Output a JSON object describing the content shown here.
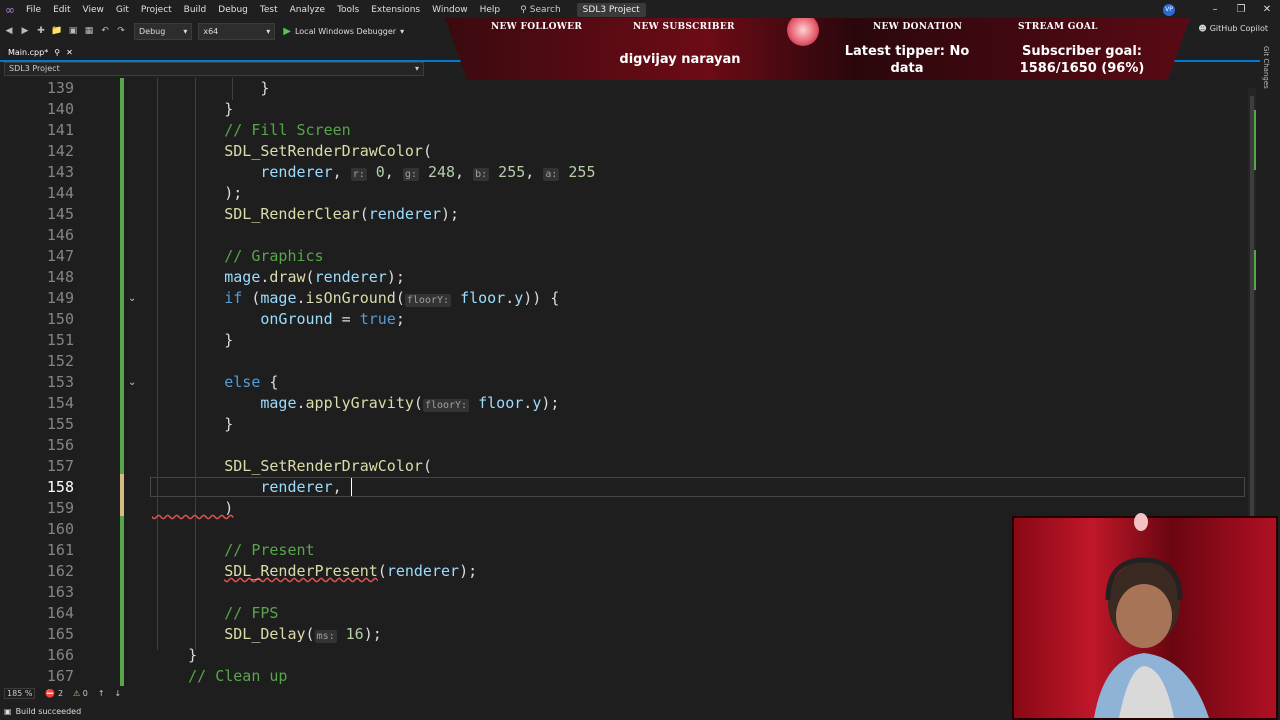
{
  "menubar": {
    "items": [
      "File",
      "Edit",
      "View",
      "Git",
      "Project",
      "Build",
      "Debug",
      "Test",
      "Analyze",
      "Tools",
      "Extensions",
      "Window",
      "Help"
    ],
    "search_label": "Search",
    "solution_name": "SDL3 Project",
    "user_initials": "VP"
  },
  "toolbar": {
    "configuration": "Debug",
    "platform": "x64",
    "run_label": "Local Windows Debugger",
    "copilot_label": "GitHub Copilot"
  },
  "tabs": {
    "active_file": "Main.cpp*"
  },
  "navbar": {
    "project": "SDL3 Project"
  },
  "overlay": {
    "labels": [
      "NEW FOLLOWER",
      "NEW SUBSCRIBER",
      "NEW DONATION",
      "STREAM GOAL"
    ],
    "follower_name": "digvijay narayan",
    "tipper_text": "Latest tipper: No data",
    "goal_text": "Subscriber goal: 1586/1650 (96%)"
  },
  "editor": {
    "line_numbers": [
      "139",
      "140",
      "141",
      "142",
      "143",
      "144",
      "145",
      "146",
      "147",
      "148",
      "149",
      "150",
      "151",
      "152",
      "153",
      "154",
      "155",
      "156",
      "157",
      "158",
      "159",
      "160",
      "161",
      "162",
      "163",
      "164",
      "165",
      "166",
      "167"
    ],
    "active_line": "158",
    "code": {
      "l141": "// Fill Screen",
      "l142_fn": "SDL_SetRenderDrawColor",
      "l143_renderer": "renderer",
      "l143_hint_r": "r:",
      "l143_r": "0",
      "l143_hint_g": "g:",
      "l143_g": "248",
      "l143_hint_b": "b:",
      "l143_b": "255",
      "l143_hint_a": "a:",
      "l143_a": "255",
      "l145_fn": "SDL_RenderClear",
      "l145_arg": "renderer",
      "l147": "// Graphics",
      "l148_obj": "mage",
      "l148_fn": "draw",
      "l148_arg": "renderer",
      "l149_kw": "if",
      "l149_obj": "mage",
      "l149_fn": "isOnGround",
      "l149_hint": "floorY:",
      "l149_arg": "floor",
      "l149_field": "y",
      "l150_var": "onGround",
      "l150_val": "true",
      "l153_kw": "else",
      "l154_obj": "mage",
      "l154_fn": "applyGravity",
      "l154_hint": "floorY:",
      "l154_arg": "floor",
      "l154_field": "y",
      "l157_fn": "SDL_SetRenderDrawColor",
      "l158_arg": "renderer",
      "l161": "// Present",
      "l162_fn": "SDL_RenderPresent",
      "l162_arg": "renderer",
      "l164": "// FPS",
      "l165_fn": "SDL_Delay",
      "l165_hint": "ms:",
      "l165_arg": "16",
      "l167": "// Clean up"
    }
  },
  "editor_status": {
    "zoom": "185 %",
    "errors": "2",
    "warnings": "0"
  },
  "statusbar": {
    "message": "Build succeeded"
  },
  "side_panel": {
    "git_changes": "Git Changes"
  },
  "colors": {
    "comment": "#57a64a",
    "function": "#dcdcaa",
    "variable": "#9cdcfe",
    "keyword": "#569cd6",
    "number": "#b5cea8",
    "accent": "#0078d4"
  }
}
